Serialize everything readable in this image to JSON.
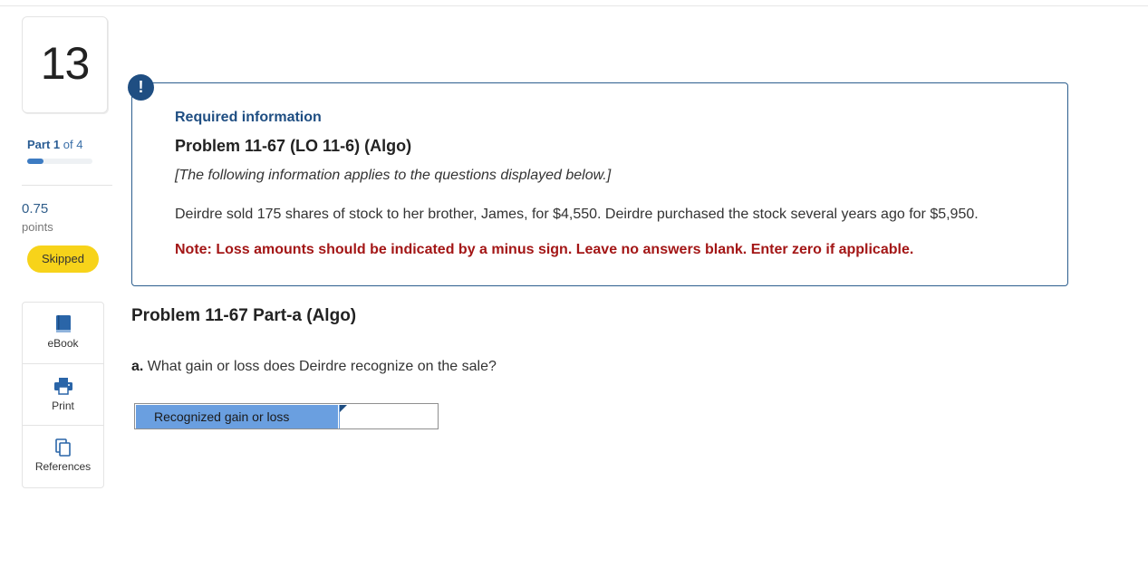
{
  "question": {
    "number": "13",
    "part_word": "Part",
    "part_current": "1",
    "part_of": "of 4",
    "progress_fraction": 0.25,
    "points_value": "0.75",
    "points_label": "points",
    "status": "Skipped"
  },
  "tools": [
    {
      "label": "eBook",
      "icon": "book-icon"
    },
    {
      "label": "Print",
      "icon": "printer-icon"
    },
    {
      "label": "References",
      "icon": "copy-icon"
    }
  ],
  "info": {
    "alert_glyph": "!",
    "required_title": "Required information",
    "problem_title": "Problem 11-67 (LO 11-6) (Algo)",
    "applies_note": "[The following information applies to the questions displayed below.]",
    "body": "Deirdre sold 175 shares of stock to her brother, James, for $4,550. Deirdre purchased the stock several years ago for $5,950.",
    "instruction": "Note: Loss amounts should be indicated by a minus sign. Leave no answers blank. Enter zero if applicable."
  },
  "part": {
    "heading": "Problem 11-67 Part-a (Algo)",
    "question_prefix": "a.",
    "question_text": "What gain or loss does Deirdre recognize on the sale?"
  },
  "answer": {
    "row_label": "Recognized gain or loss",
    "value": ""
  },
  "colors": {
    "accent": "#1f4e82",
    "skipped": "#f7d31a",
    "warning_text": "#a31616",
    "answer_label_bg": "#6a9fe0"
  }
}
